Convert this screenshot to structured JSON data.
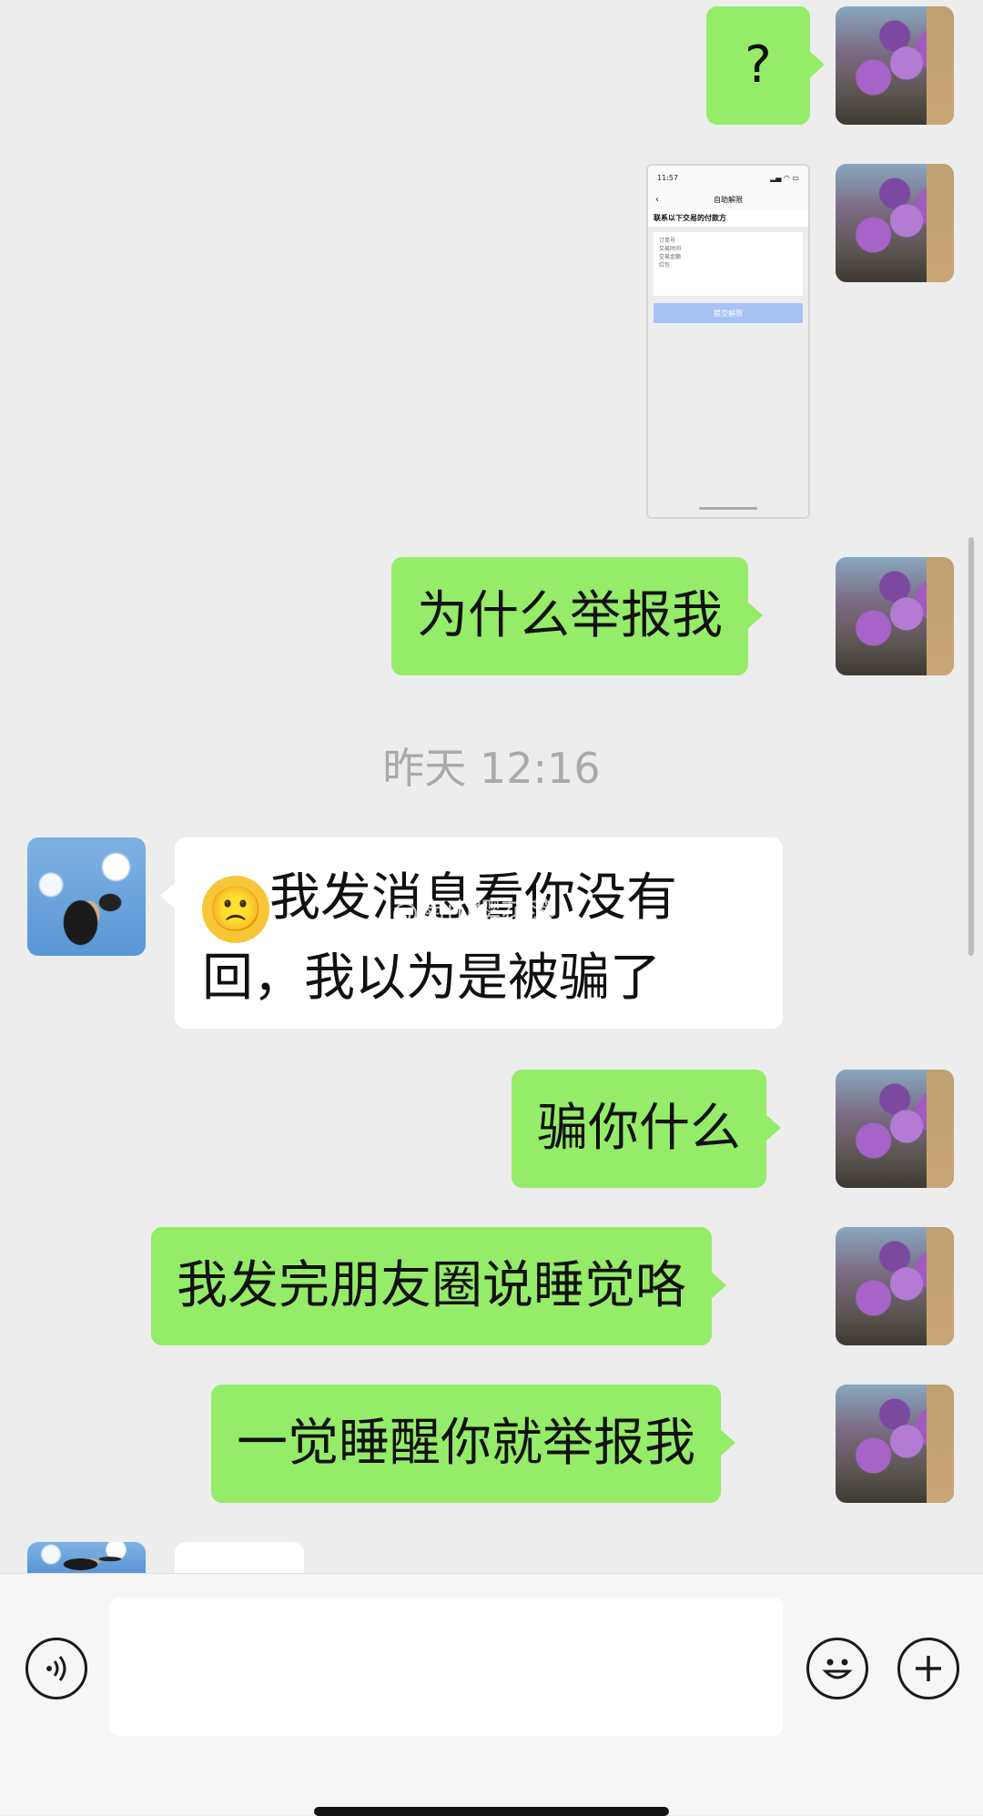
{
  "messages": {
    "m1": "?",
    "m3": "为什么举报我",
    "timestamp": "昨天 12:16",
    "m4_line1": "我发消息看你没有",
    "m4_line2": "回，我以为是被骗了",
    "m4_emoji": "🙁",
    "m5": "骗你什么",
    "m6": "我发完朋友圈说睡觉咯",
    "m7": "一觉睡醒你就举报我"
  },
  "thumbnail": {
    "status_time": "11:57",
    "nav_title": "自助解限",
    "header": "联系以下交易的付款方",
    "row1": "订单号",
    "row2": "交易时间",
    "row3": "交易金额",
    "row4": "红包",
    "button": "提交解限"
  },
  "watermark": "@南山樱花落",
  "input_bar": {
    "voice_icon": "voice-icon",
    "emoji_icon": "emoji-icon",
    "plus_icon": "plus-icon"
  }
}
